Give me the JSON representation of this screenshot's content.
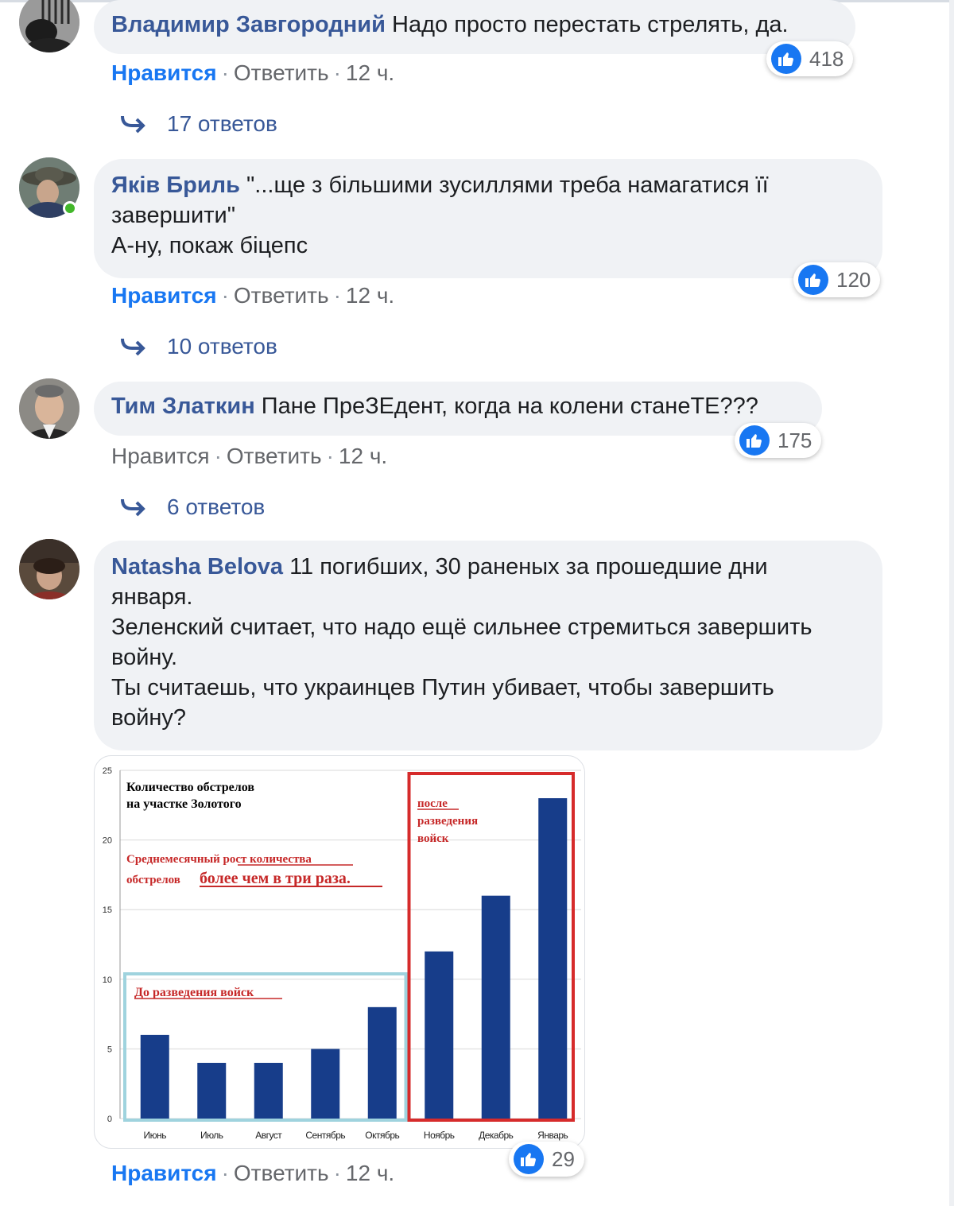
{
  "comments": [
    {
      "author": "Владимир Завгородний",
      "text_lines": [
        "Надо просто перестать стрелять, да."
      ],
      "like_count": "418",
      "actions": {
        "like": "Нравится",
        "reply": "Ответить",
        "time": "12 ч."
      },
      "replies_label": "17 ответов"
    },
    {
      "author": "Яків Бриль",
      "text_lines": [
        "\"...ще з більшими зусиллями треба намагатися її",
        "завершити\"",
        "А-ну, покаж біцепс"
      ],
      "like_count": "120",
      "actions": {
        "like": "Нравится",
        "reply": "Ответить",
        "time": "12 ч."
      },
      "replies_label": "10 ответов"
    },
    {
      "author": "Тим Златкин",
      "text_lines": [
        "Пане ПреЗЕдент, когда на колени стане",
        "ТЕ???"
      ],
      "like_count": "175",
      "actions": {
        "like": "Нравится",
        "reply": "Ответить",
        "time": "12 ч."
      },
      "replies_label": "6 ответов"
    },
    {
      "author": "Natasha Belova",
      "text_lines": [
        "11 погибших, 30 раненых за прошедшие дни",
        "января.",
        "Зеленский считает, что надо ещё сильнее стремиться завершить",
        "войну.",
        "Ты считаешь, что украинцев Путин убивает, чтобы завершить",
        "войну?"
      ],
      "like_count": "29",
      "actions": {
        "like": "Нравится",
        "reply": "Ответить",
        "time": "12 ч."
      }
    }
  ],
  "chart_data": {
    "type": "bar",
    "title": "Количество обстрелов на участке Золотого",
    "annotation_growth": "Среднемесячный рост количества обстрелов более чем в три раза.",
    "annotation_growth_lines": [
      "Среднемесячный рост количества",
      "обстрелов",
      "более чем в три раза."
    ],
    "annotation_before": "До разведения войск",
    "annotation_after": "после разведения войск",
    "annotation_after_lines": [
      "после",
      "разведения",
      "войск"
    ],
    "categories": [
      "Июнь",
      "Июль",
      "Август",
      "Сентябрь",
      "Октябрь",
      "Ноябрь",
      "Декабрь",
      "Январь"
    ],
    "values": [
      6,
      4,
      4,
      5,
      8,
      12,
      16,
      23
    ],
    "y_ticks": [
      "0",
      "5",
      "10",
      "15",
      "20",
      "25"
    ],
    "ylim": [
      0,
      25
    ],
    "grid": true,
    "bar_color": "#173d8a",
    "before_box_color": "#9fd3de",
    "after_box_color": "#d62b2b"
  }
}
